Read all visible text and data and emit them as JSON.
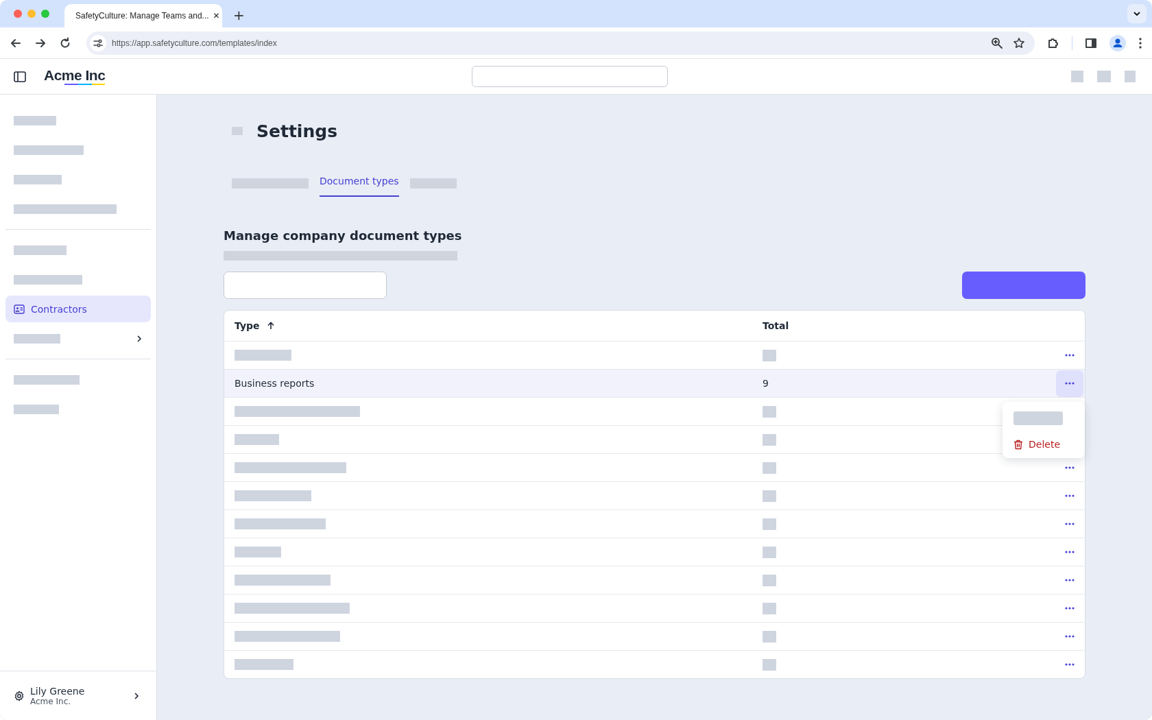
{
  "browser": {
    "tab_title": "SafetyCulture: Manage Teams and...",
    "tab_close": "✕",
    "new_tab": "+",
    "url": "https://app.safetyculture.com/templates/index"
  },
  "header": {
    "logo": "Acme Inc"
  },
  "sidebar": {
    "groups": [
      [
        {
          "kind": "placeholder"
        },
        {
          "kind": "placeholder"
        },
        {
          "kind": "placeholder"
        },
        {
          "kind": "placeholder"
        }
      ],
      [
        {
          "kind": "placeholder"
        },
        {
          "kind": "placeholder"
        },
        {
          "kind": "link",
          "label": "Contractors",
          "selected": true
        },
        {
          "kind": "placeholder",
          "expandable": true
        }
      ],
      [
        {
          "kind": "placeholder"
        },
        {
          "kind": "placeholder"
        }
      ]
    ],
    "user": {
      "name": "Lily Greene",
      "org": "Acme Inc."
    }
  },
  "page": {
    "title": "Settings",
    "heading": "Manage company document types",
    "tabs": [
      {
        "kind": "placeholder",
        "selected": false
      },
      {
        "kind": "text",
        "label": "Document types",
        "selected": true
      },
      {
        "kind": "placeholder",
        "selected": false
      }
    ]
  },
  "table": {
    "columns": [
      {
        "label": "Type",
        "sorted_ascending": true
      },
      {
        "label": "Total"
      }
    ],
    "rows": [
      {
        "kind": "placeholder",
        "selected": false,
        "actions": true
      },
      {
        "kind": "text",
        "type": "Business reports",
        "total": "9",
        "selected": true,
        "actions": true
      },
      {
        "kind": "placeholder",
        "selected": false,
        "actions": false
      },
      {
        "kind": "placeholder",
        "selected": false,
        "actions": false
      },
      {
        "kind": "placeholder",
        "selected": false,
        "actions": true
      },
      {
        "kind": "placeholder",
        "selected": false,
        "actions": true
      },
      {
        "kind": "placeholder",
        "selected": false,
        "actions": true
      },
      {
        "kind": "placeholder",
        "selected": false,
        "actions": true
      },
      {
        "kind": "placeholder",
        "selected": false,
        "actions": true
      },
      {
        "kind": "placeholder",
        "selected": false,
        "actions": true
      },
      {
        "kind": "placeholder",
        "selected": false,
        "actions": true
      },
      {
        "kind": "placeholder",
        "selected": false,
        "actions": true
      }
    ]
  },
  "menu": {
    "items": [
      {
        "kind": "placeholder"
      },
      {
        "kind": "danger",
        "label": "Delete"
      }
    ]
  }
}
